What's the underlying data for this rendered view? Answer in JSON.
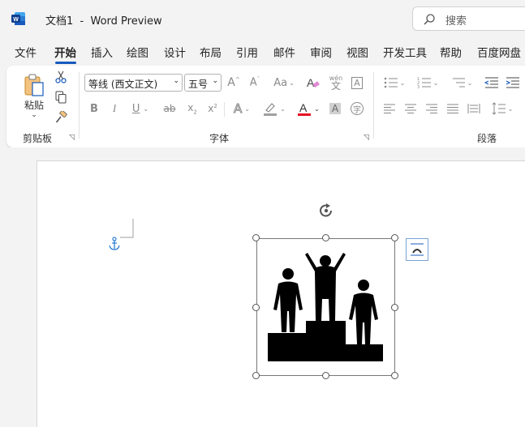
{
  "window": {
    "title": "文档1  -  Word Preview",
    "search_placeholder": "搜索"
  },
  "tabs": [
    {
      "label": "文件"
    },
    {
      "label": "开始",
      "active": true
    },
    {
      "label": "插入"
    },
    {
      "label": "绘图"
    },
    {
      "label": "设计"
    },
    {
      "label": "布局"
    },
    {
      "label": "引用"
    },
    {
      "label": "邮件"
    },
    {
      "label": "审阅"
    },
    {
      "label": "视图"
    },
    {
      "label": "开发工具"
    },
    {
      "label": "帮助"
    },
    {
      "label": "百度网盘"
    }
  ],
  "ribbon": {
    "clipboard": {
      "label": "剪贴板",
      "paste_label": "粘贴"
    },
    "font": {
      "label": "字体",
      "font_name": "等线 (西文正文)",
      "font_size": "五号",
      "change_case_label": "Aa",
      "phonetic_label": "wén"
    },
    "paragraph": {
      "label": "段落"
    }
  },
  "colors": {
    "accent": "#185abd",
    "font_color_bar": "#e81123",
    "highlight_bar": "#a0a0a0",
    "anchor": "#2b7cd3"
  },
  "icons": {
    "app": "word-icon",
    "image": "podium-winners-icon",
    "layout_options": "layout-options-icon",
    "anchor": "anchor-icon",
    "rotate": "rotate-handle-icon"
  }
}
